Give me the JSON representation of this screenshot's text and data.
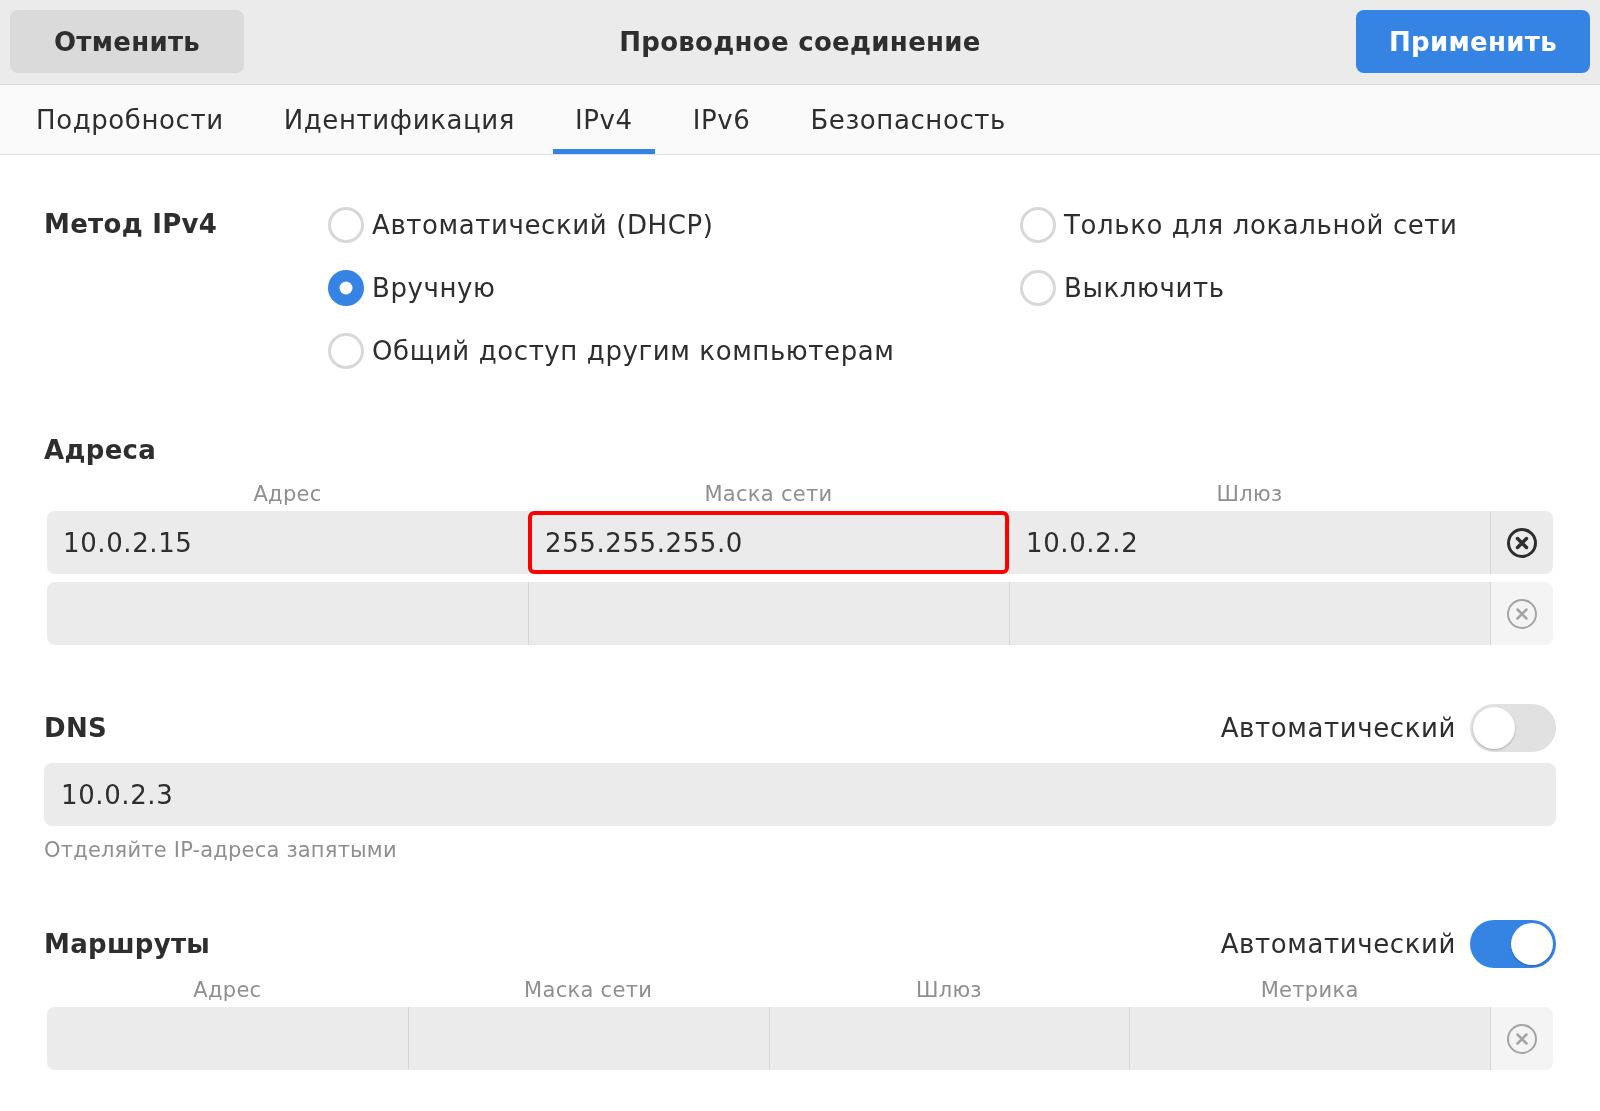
{
  "header": {
    "cancel_button": "Отменить",
    "title": "Проводное соединение",
    "apply_button": "Применить"
  },
  "tabs": [
    {
      "label": "Подробности",
      "selected": false
    },
    {
      "label": "Идентификация",
      "selected": false
    },
    {
      "label": "IPv4",
      "selected": true
    },
    {
      "label": "IPv6",
      "selected": false
    },
    {
      "label": "Безопасность",
      "selected": false
    }
  ],
  "ipv4_method": {
    "label": "Метод IPv4",
    "options": [
      {
        "label": "Автоматический (DHCP)",
        "selected": false
      },
      {
        "label": "Только для локальной сети",
        "selected": false
      },
      {
        "label": "Вручную",
        "selected": true
      },
      {
        "label": "Выключить",
        "selected": false
      },
      {
        "label": "Общий доступ другим компьютерам",
        "selected": false
      }
    ]
  },
  "addresses": {
    "title": "Адреса",
    "columns": [
      "Адрес",
      "Маска сети",
      "Шлюз"
    ],
    "rows": [
      {
        "cells": [
          {
            "value": "10.0.2.15",
            "highlighted": false
          },
          {
            "value": "255.255.255.0",
            "highlighted": true
          },
          {
            "value": "10.0.2.2",
            "highlighted": false
          }
        ],
        "remove_enabled": true
      },
      {
        "cells": [
          {
            "highlighted": false
          },
          {
            "highlighted": false
          },
          {
            "highlighted": false
          }
        ],
        "remove_enabled": false
      }
    ]
  },
  "dns": {
    "title": "DNS",
    "automatic_label": "Автоматический",
    "automatic": false,
    "value": "10.0.2.3",
    "hint": "Отделяйте IP-адреса запятыми"
  },
  "routes": {
    "title": "Маршруты",
    "automatic_label": "Автоматический",
    "automatic": true,
    "columns": [
      "Адрес",
      "Маска сети",
      "Шлюз",
      "Метрика"
    ],
    "rows": [
      {
        "cells": [
          {
            "highlighted": false
          },
          {
            "highlighted": false
          },
          {
            "highlighted": false
          },
          {
            "highlighted": false
          }
        ],
        "remove_enabled": false
      }
    ]
  }
}
